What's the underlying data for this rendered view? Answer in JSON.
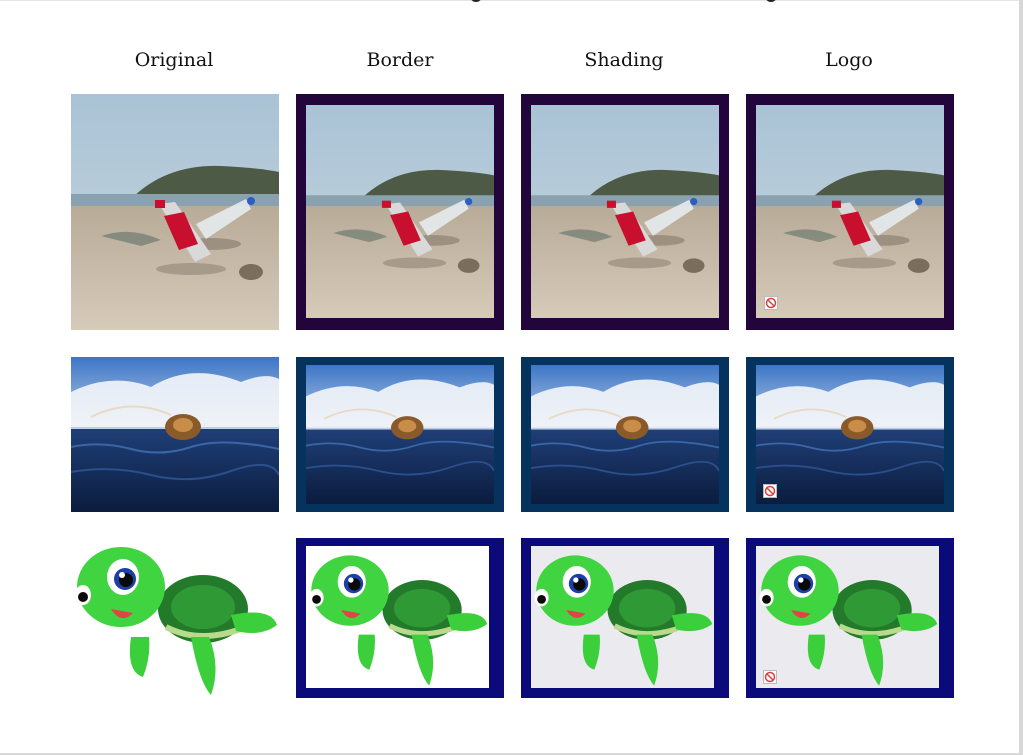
{
  "columns": {
    "original": "Original",
    "border": "Border",
    "shading": "Shading",
    "logo": "Logo"
  },
  "colors": {
    "row1_border": "#22053a",
    "row2_border": "#06335e",
    "row3_border": "#0a0a7a",
    "shading_fill": "#ebebef"
  },
  "rows": [
    {
      "subject": "plastic bottles on a beach"
    },
    {
      "subject": "sea turtle swimming in the ocean"
    },
    {
      "subject": "cartoon green turtle"
    }
  ],
  "icons": {
    "logo_mark": "no-sign-icon"
  }
}
